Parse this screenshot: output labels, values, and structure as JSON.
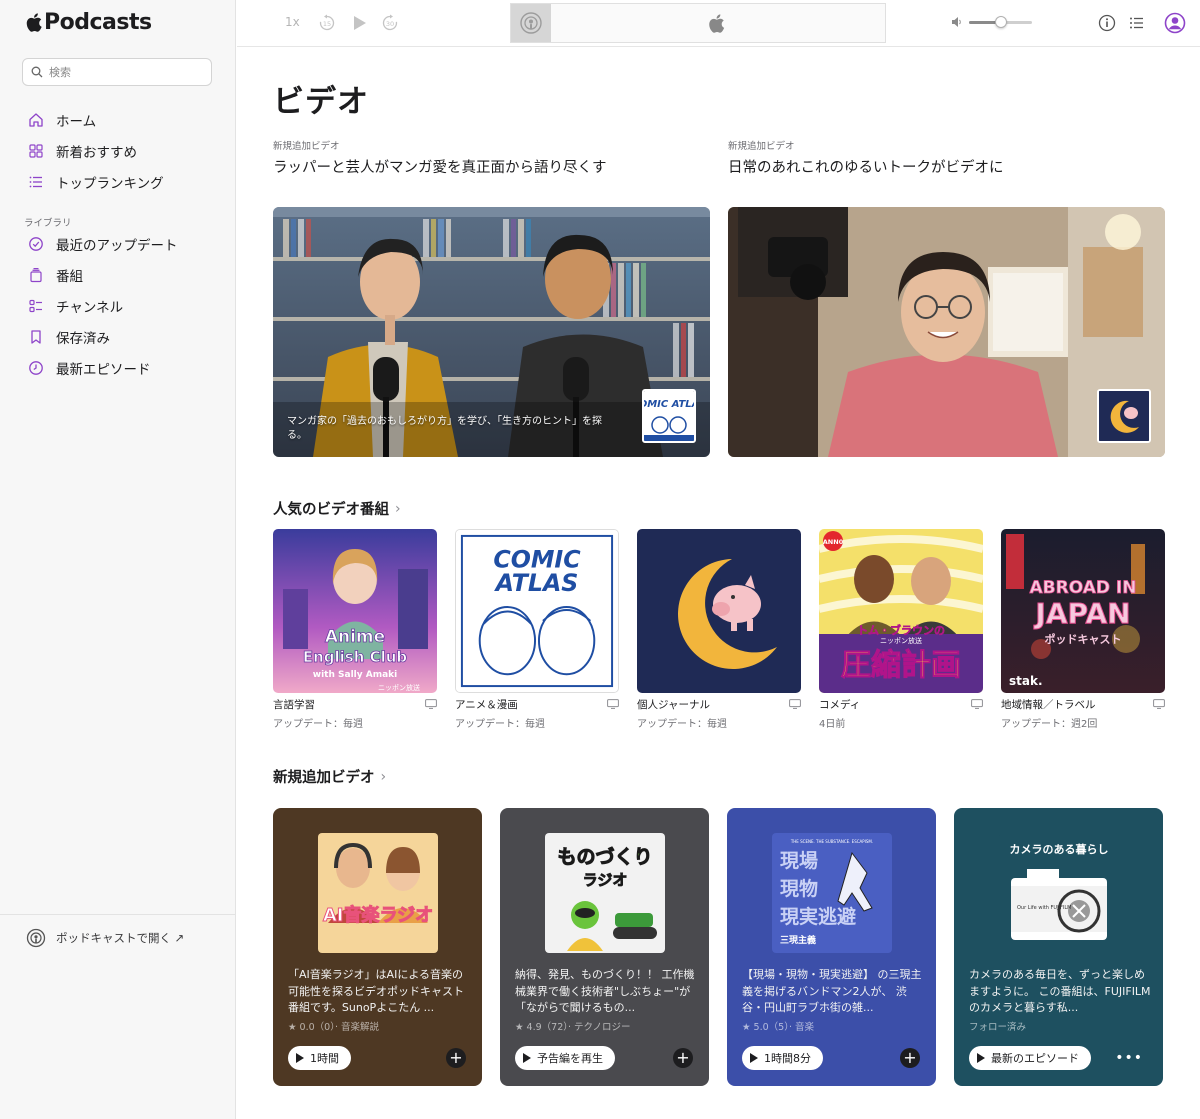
{
  "app": {
    "name": "Podcasts"
  },
  "search": {
    "placeholder": "検索"
  },
  "nav": {
    "main": [
      {
        "label": "ホーム",
        "icon": "home-icon"
      },
      {
        "label": "新着おすすめ",
        "icon": "grid-icon"
      },
      {
        "label": "トップランキング",
        "icon": "list-icon"
      }
    ],
    "library_label": "ライブラリ",
    "library": [
      {
        "label": "最近のアップデート",
        "icon": "checkmark-circle-icon"
      },
      {
        "label": "番組",
        "icon": "stack-icon"
      },
      {
        "label": "チャンネル",
        "icon": "channels-icon"
      },
      {
        "label": "保存済み",
        "icon": "bookmark-icon"
      },
      {
        "label": "最新エピソード",
        "icon": "clock-icon"
      }
    ],
    "open_in_podcasts": "ポッドキャストで開く ↗"
  },
  "player": {
    "speed": "1x",
    "skip_back": "15",
    "skip_forward": "30",
    "volume": 0.5
  },
  "page": {
    "title": "ビデオ"
  },
  "features": [
    {
      "eyebrow": "新規追加ビデオ",
      "title": "ラッパーと芸人がマンガ愛を真正面から語り尽くす",
      "caption": "マンガ家の「過去のおもしろがり方」を学び、「生き方のヒント」を探る。",
      "badge": "COMIC ATLAS"
    },
    {
      "eyebrow": "新規追加ビデオ",
      "title": "日常のあれこれのゆるいトークがビデオに",
      "caption": "",
      "badge": ""
    }
  ],
  "popular": {
    "heading": "人気のビデオ番組",
    "shows": [
      {
        "category": "言語学習",
        "update": "アップデート：毎週",
        "art_title_1": "Anime",
        "art_title_2": "English Club",
        "art_title_3": "with Sally Amaki",
        "art_sub": "ニッポン放送"
      },
      {
        "category": "アニメ＆漫画",
        "update": "アップデート：毎週",
        "art_title_1": "COMIC",
        "art_title_2": "ATLAS"
      },
      {
        "category": "個人ジャーナル",
        "update": "アップデート：毎週"
      },
      {
        "category": "コメディ",
        "update": "4日前",
        "art_title_1": "トム・ブラウンの",
        "art_title_2": "圧縮計画",
        "art_sub": "ニッポン放送",
        "art_badge": "ANN0"
      },
      {
        "category": "地域情報／トラベル",
        "update": "アップデート：週2回",
        "art_title_1": "ABROAD IN",
        "art_title_2": "JAPAN",
        "art_sub": "ポッドキャスト",
        "art_brand": "stak."
      }
    ]
  },
  "new_videos": {
    "heading": "新規追加ビデオ",
    "cards": [
      {
        "bg": "#4e3823",
        "desc": "「AI音楽ラジオ」はAIによる音楽の可能性を探るビデオポッドキャスト番組です。SunoPよこたん ...",
        "rating": "★ 0.0（0）· 音楽解説",
        "button": "1時間",
        "action": "add",
        "art_title": "AI音楽ラジオ"
      },
      {
        "bg": "#4a4a4e",
        "desc": "納得、発見、ものづくり！！ 工作機械業界で働く技術者\"しぶちょー\"が 「ながらで聞けるもの...",
        "rating": "★ 4.9（72）· テクノロジー",
        "button": "予告編を再生",
        "action": "add",
        "art_title": "ものづくり",
        "art_sub": "ラジオ"
      },
      {
        "bg": "#3c4fa9",
        "desc": "【現場・現物・現実逃避】 の三現主義を掲げるバンドマン2人が、 渋谷・円山町ラブホ街の雑...",
        "rating": "★ 5.0（5）· 音楽",
        "button": "1時間8分",
        "action": "add",
        "art_title_1": "現場",
        "art_title_2": "現物",
        "art_title_3": "現実逃避",
        "art_top": "THE SCENE. THE SUBSTANCE. ESCAPISM.",
        "art_sub": "三現主義"
      },
      {
        "bg": "#1e5060",
        "desc": "カメラのある毎日を、ずっと楽しめますように。 この番組は、FUJIFILM のカメラと暮らす私...",
        "rating": "フォロー済み",
        "button": "最新のエピソード",
        "action": "more",
        "art_title": "カメラのある暮らし",
        "art_brand": "Our Life with FUJIFILM"
      }
    ]
  },
  "colors": {
    "accent": "#8e44c9",
    "text": "#1d1d1f",
    "secondary": "#6e6e73"
  }
}
